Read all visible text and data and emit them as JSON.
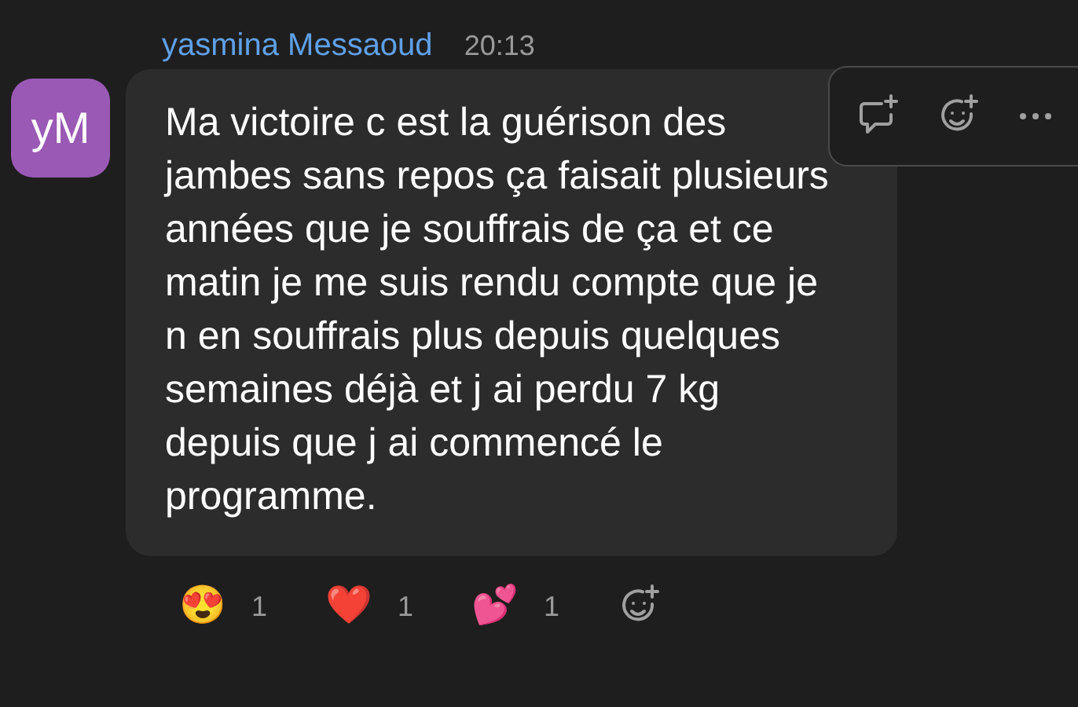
{
  "message": {
    "author": "yasmina Messaoud",
    "time": "20:13",
    "avatar_initials": "yM",
    "text": "Ma victoire c est la guérison des jambes sans repos ça faisait plusieurs années que je souffrais de ça et ce matin je me suis rendu compte que je n en souffrais plus depuis quelques semaines déjà et j ai perdu 7 kg depuis que j ai commencé le programme."
  },
  "reactions": [
    {
      "emoji": "😍",
      "count": "1"
    },
    {
      "emoji": "❤️",
      "count": "1"
    },
    {
      "emoji": "💕",
      "count": "1"
    }
  ]
}
